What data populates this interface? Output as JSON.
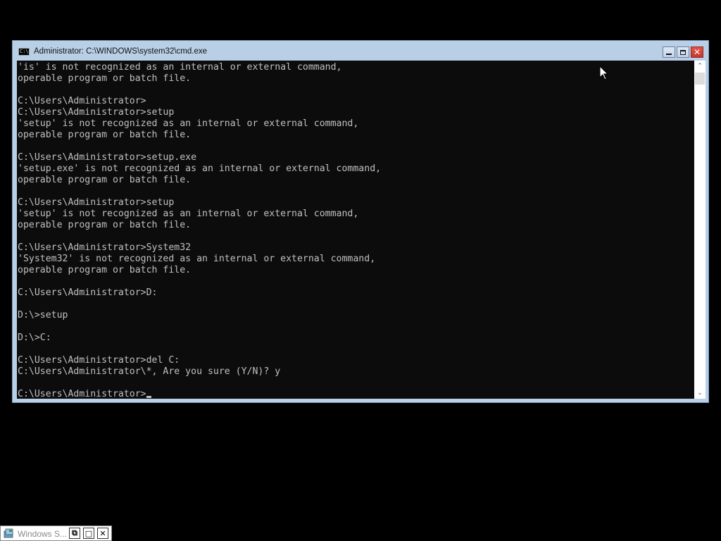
{
  "window": {
    "title": "Administrator: C:\\WINDOWS\\system32\\cmd.exe",
    "icon_label": "C:\\",
    "minimize_symbol": "",
    "maximize_symbol": "",
    "close_symbol": "✕"
  },
  "console": {
    "lines": [
      "'is' is not recognized as an internal or external command,",
      "operable program or batch file.",
      "",
      "C:\\Users\\Administrator>",
      "C:\\Users\\Administrator>setup",
      "'setup' is not recognized as an internal or external command,",
      "operable program or batch file.",
      "",
      "C:\\Users\\Administrator>setup.exe",
      "'setup.exe' is not recognized as an internal or external command,",
      "operable program or batch file.",
      "",
      "C:\\Users\\Administrator>setup",
      "'setup' is not recognized as an internal or external command,",
      "operable program or batch file.",
      "",
      "C:\\Users\\Administrator>System32",
      "'System32' is not recognized as an internal or external command,",
      "operable program or batch file.",
      "",
      "C:\\Users\\Administrator>D:",
      "",
      "D:\\>setup",
      "",
      "D:\\>C:",
      "",
      "C:\\Users\\Administrator>del C:",
      "C:\\Users\\Administrator\\*, Are you sure (Y/N)? y",
      ""
    ],
    "prompt": "C:\\Users\\Administrator>",
    "text_color": "#c0c0c0",
    "background": "#0c0c0c"
  },
  "scrollbar": {
    "up_arrow": "⌃",
    "down_arrow": "⌄"
  },
  "taskbar": {
    "item_label": "Windows S...",
    "restore_symbol": "⧉",
    "maximize_symbol": "□",
    "close_symbol": "✕"
  },
  "colors": {
    "desktop": "#000000",
    "window_frame": "#b9cfe6",
    "close_button": "#c7362d"
  }
}
